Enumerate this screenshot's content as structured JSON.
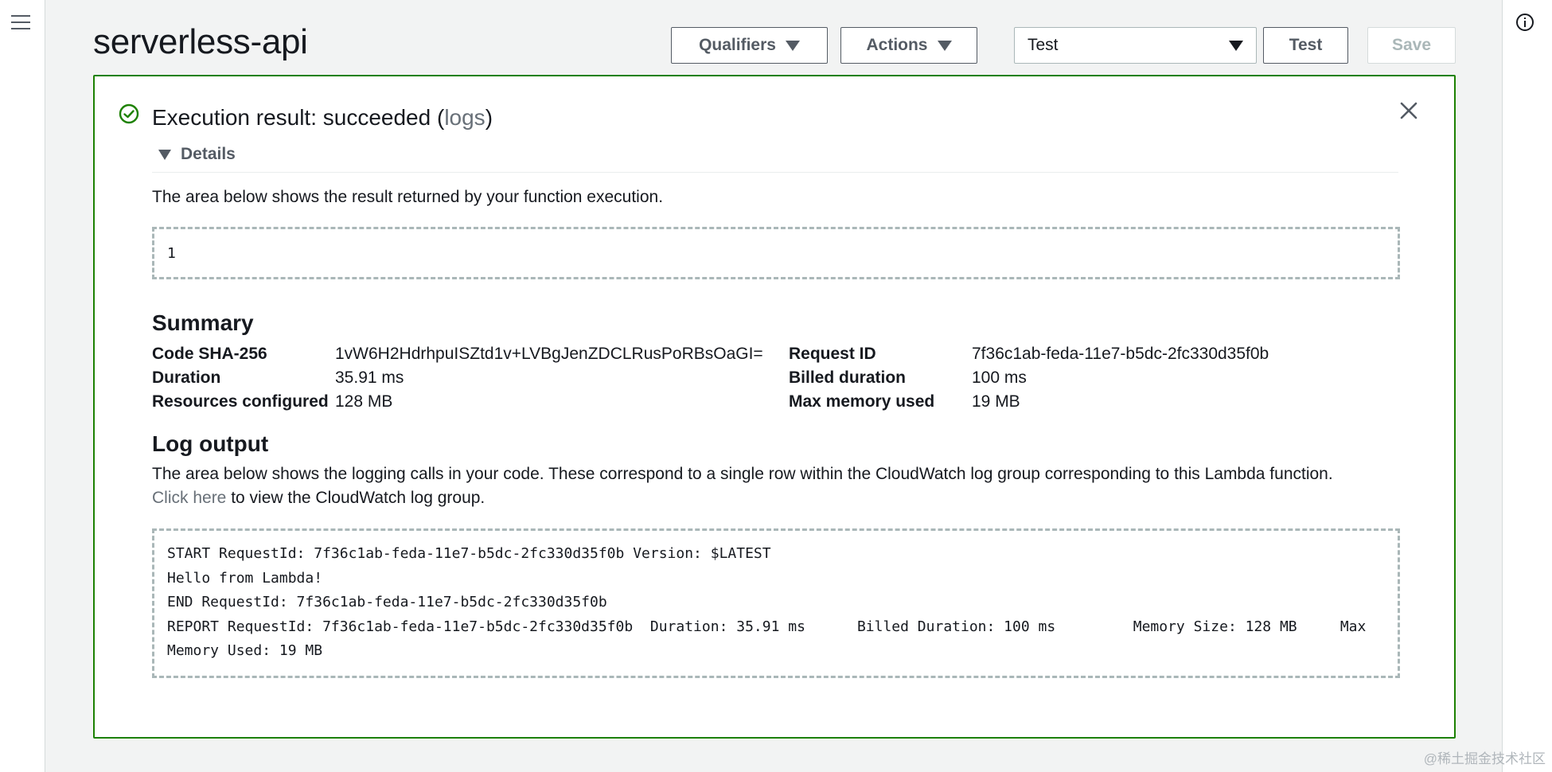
{
  "header": {
    "title": "serverless-api",
    "qualifiers_label": "Qualifiers",
    "actions_label": "Actions",
    "test_event_selected": "Test",
    "test_label": "Test",
    "save_label": "Save"
  },
  "result": {
    "title_prefix": "Execution result: succeeded (",
    "title_link": "logs",
    "title_suffix": ")",
    "details_label": "Details",
    "description": "The area below shows the result returned by your function execution.",
    "returned_value": "1"
  },
  "summary": {
    "heading": "Summary",
    "left": [
      {
        "key": "Code SHA-256",
        "value": "1vW6H2HdrhpuISZtd1v+LVBgJenZDCLRusPoRBsOaGI="
      },
      {
        "key": "Duration",
        "value": "35.91 ms"
      },
      {
        "key": "Resources configured",
        "value": "128 MB"
      }
    ],
    "right": [
      {
        "key": "Request ID",
        "value": "7f36c1ab-feda-11e7-b5dc-2fc330d35f0b"
      },
      {
        "key": "Billed duration",
        "value": "100 ms"
      },
      {
        "key": "Max memory used",
        "value": "19 MB"
      }
    ]
  },
  "log": {
    "heading": "Log output",
    "description": "The area below shows the logging calls in your code. These correspond to a single row within the CloudWatch log group corresponding to this Lambda function.",
    "link_text": "Click here",
    "link_suffix": " to view the CloudWatch log group.",
    "lines": [
      "START RequestId: 7f36c1ab-feda-11e7-b5dc-2fc330d35f0b Version: $LATEST",
      "Hello from Lambda!",
      "END RequestId: 7f36c1ab-feda-11e7-b5dc-2fc330d35f0b",
      "REPORT RequestId: 7f36c1ab-feda-11e7-b5dc-2fc330d35f0b  Duration: 35.91 ms      Billed Duration: 100 ms         Memory Size: 128 MB     Max",
      "Memory Used: 19 MB"
    ]
  },
  "watermark": "@稀土掘金技术社区",
  "icons": {
    "menu": "hamburger-icon",
    "info": "info-icon",
    "success": "check-circle-icon",
    "close": "close-icon",
    "dropdown": "caret-down-icon"
  },
  "colors": {
    "success": "#1d8102",
    "link": "#687078",
    "border": "#545b64"
  }
}
